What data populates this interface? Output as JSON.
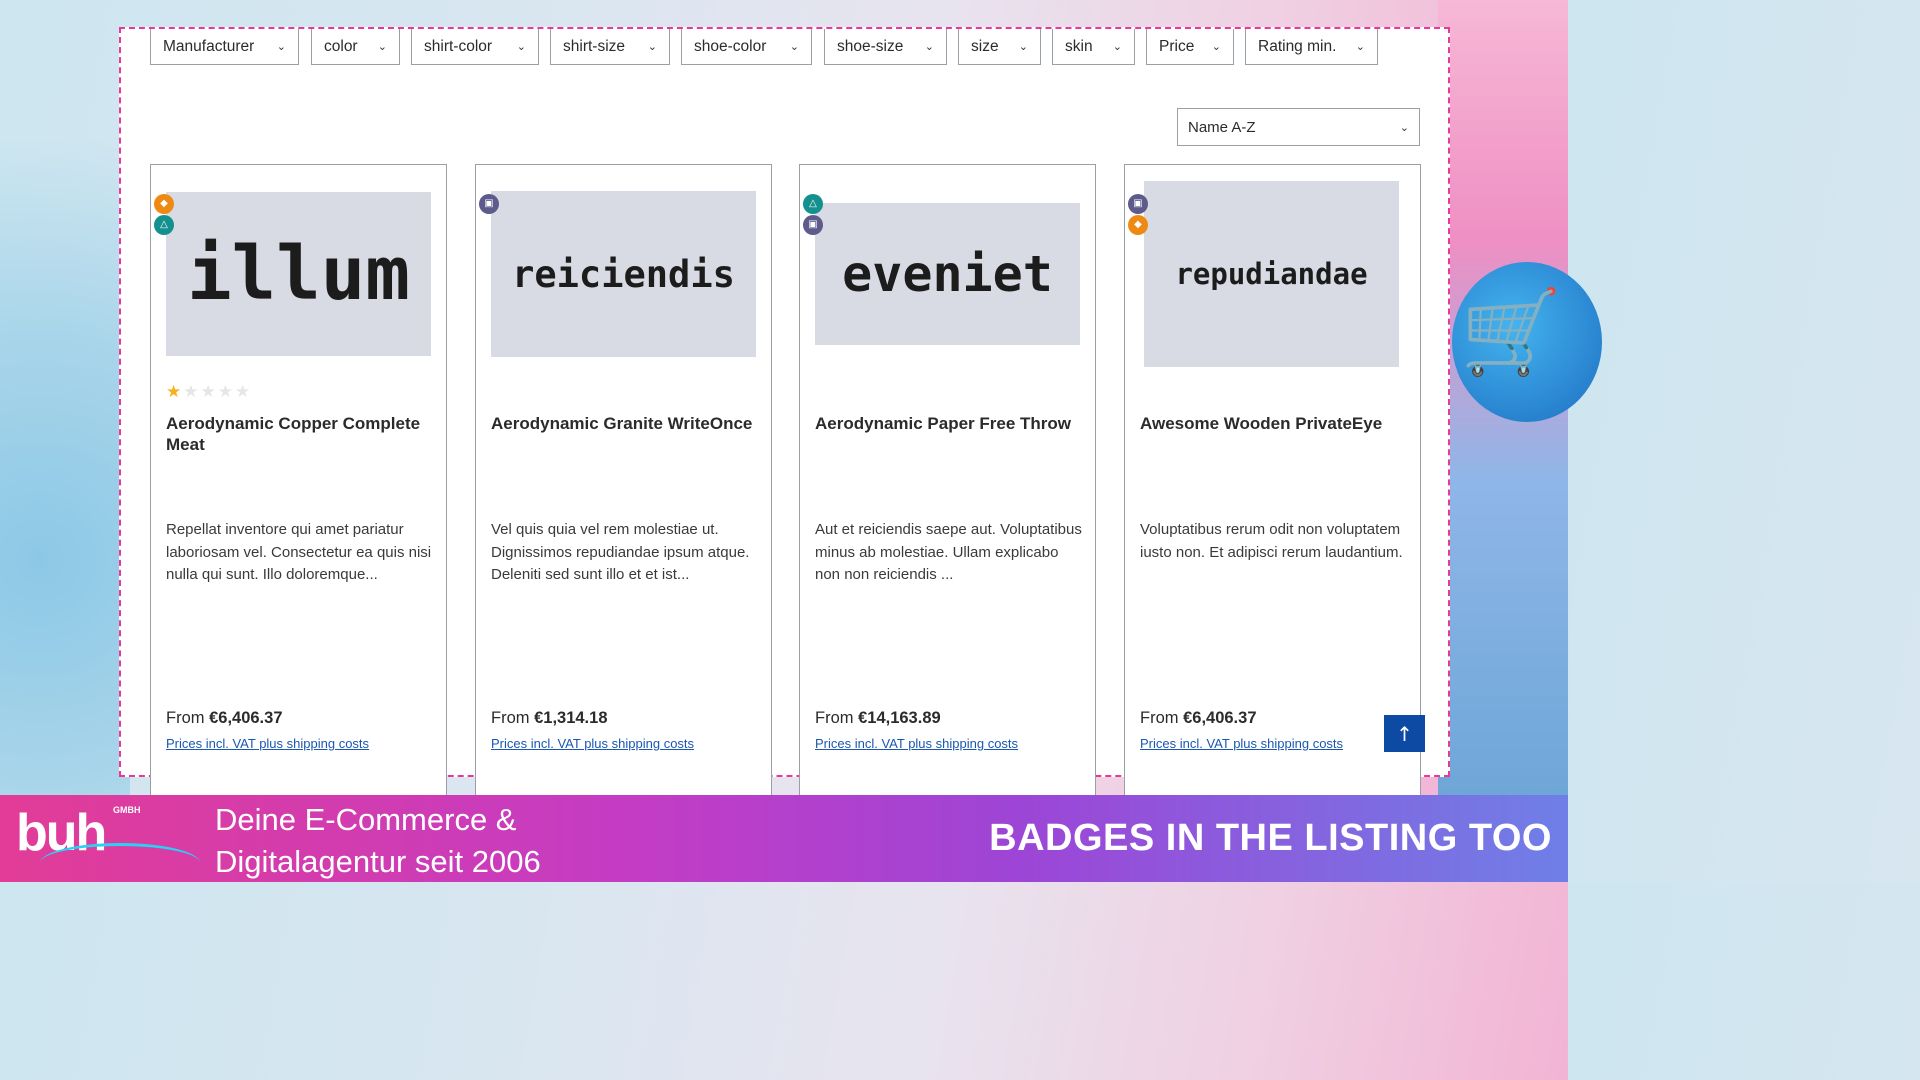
{
  "filters": [
    {
      "label": "Manufacturer"
    },
    {
      "label": "color"
    },
    {
      "label": "shirt-color"
    },
    {
      "label": "shirt-size"
    },
    {
      "label": "shoe-color"
    },
    {
      "label": "shoe-size"
    },
    {
      "label": "size"
    },
    {
      "label": "skin"
    },
    {
      "label": "Price"
    },
    {
      "label": "Rating min."
    }
  ],
  "sort": {
    "selected": "Name A-Z"
  },
  "products": [
    {
      "thumb_text": "illum",
      "badges": [
        "orange-diamond-badge",
        "teal-triangle-badge"
      ],
      "rating": 1,
      "name": "Aerodynamic Copper Complete Meat",
      "description": "Repellat inventore qui amet pariatur laboriosam vel. Consectetur ea quis nisi nulla qui sunt. Illo doloremque...",
      "price_prefix": "From",
      "price": "€6,406.37",
      "vat_link": "Prices incl. VAT plus shipping costs"
    },
    {
      "thumb_text": "reiciendis",
      "badges": [
        "purple-square-badge"
      ],
      "rating": null,
      "name": "Aerodynamic Granite WriteOnce",
      "description": "Vel quis quia vel rem molestiae ut. Dignissimos repudiandae ipsum atque. Deleniti sed sunt illo et et ist...",
      "price_prefix": "From",
      "price": "€1,314.18",
      "vat_link": "Prices incl. VAT plus shipping costs"
    },
    {
      "thumb_text": "eveniet",
      "badges": [
        "teal-triangle-badge",
        "purple-square-badge"
      ],
      "rating": null,
      "name": "Aerodynamic Paper Free Throw",
      "description": "Aut et reiciendis saepe aut. Voluptatibus minus ab molestiae. Ullam explicabo non non reiciendis ...",
      "price_prefix": "From",
      "price": "€14,163.89",
      "vat_link": "Prices incl. VAT plus shipping costs"
    },
    {
      "thumb_text": "repudiandae",
      "badges": [
        "purple-square-badge",
        "orange-diamond-badge"
      ],
      "rating": null,
      "name": "Awesome Wooden PrivateEye",
      "description": "Voluptatibus rerum odit non voluptatem iusto non. Et adipisci rerum laudantium.",
      "price_prefix": "From",
      "price": "€6,406.37",
      "vat_link": "Prices incl. VAT plus shipping costs"
    }
  ],
  "scroll_top": {
    "icon": "arrow-up-icon"
  },
  "footer": {
    "logo": "buh",
    "logo_suffix": "GMBH",
    "tagline_line1": "Deine E-Commerce &",
    "tagline_line2": "Digitalagentur seit 2006",
    "headline": "BADGES IN THE LISTING TOO"
  },
  "colors": {
    "frame_border": "#e8399b",
    "badge_orange": "#ee8a14",
    "badge_teal": "#14908f",
    "badge_purple": "#5d5a8c",
    "link": "#1a57b3",
    "scroll_top_bg": "#0d4aa3"
  }
}
